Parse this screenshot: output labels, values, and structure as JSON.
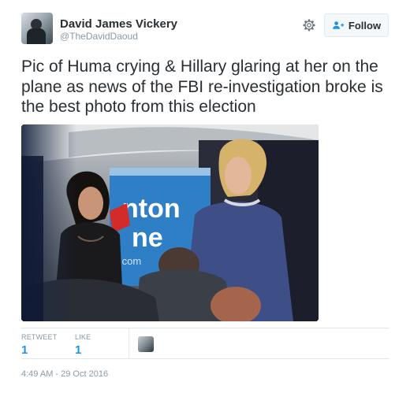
{
  "author": {
    "name": "David James Vickery",
    "handle": "@TheDavidDaoud"
  },
  "actions": {
    "follow_label": "Follow",
    "settings_icon": "gear-icon",
    "follow_icon": "person-add-icon"
  },
  "tweet": {
    "text": "Pic of Huma crying & Hillary glaring at her on the plane as  news of the FBI re-investigation broke is the best photo from this  election",
    "photo": {
      "sign_line1": "nton",
      "sign_line2": "ne",
      "sign_line3": ".com"
    }
  },
  "stats": {
    "retweet_label": "RETWEET",
    "retweet_count": "1",
    "like_label": "LIKE",
    "like_count": "1"
  },
  "timestamp": "4:49 AM - 29 Oct 2016",
  "colors": {
    "link_blue": "#1b95e0",
    "muted_text": "#8899a6",
    "border": "#e1e8ed"
  }
}
